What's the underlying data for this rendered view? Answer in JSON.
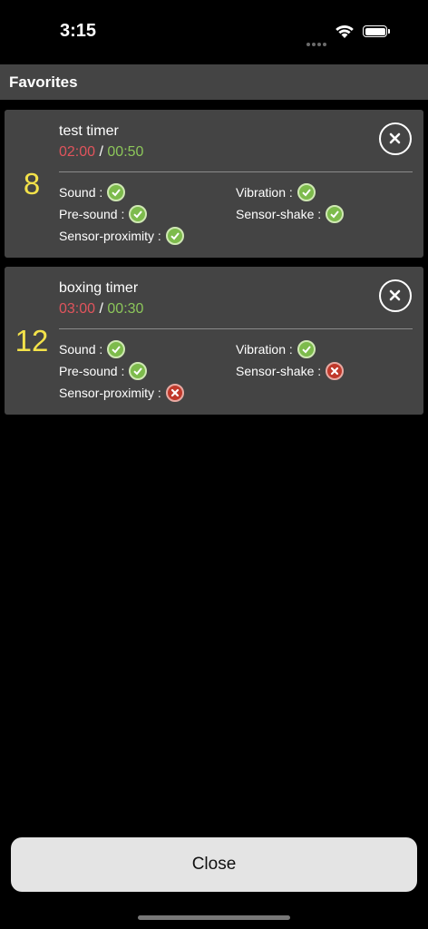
{
  "status_bar": {
    "time": "3:15"
  },
  "header": {
    "title": "Favorites"
  },
  "cards": [
    {
      "number": "8",
      "name": "test timer",
      "time_main": "02:00",
      "time_separator": "/",
      "time_rest": "00:50",
      "options": [
        {
          "label": "Sound :",
          "enabled": true
        },
        {
          "label": "Vibration :",
          "enabled": true
        },
        {
          "label": "Pre-sound :",
          "enabled": true
        },
        {
          "label": "Sensor-shake :",
          "enabled": true
        },
        {
          "label": "Sensor-proximity :",
          "enabled": true
        }
      ]
    },
    {
      "number": "12",
      "name": "boxing timer",
      "time_main": "03:00",
      "time_separator": "/",
      "time_rest": "00:30",
      "options": [
        {
          "label": "Sound :",
          "enabled": true
        },
        {
          "label": "Vibration :",
          "enabled": true
        },
        {
          "label": "Pre-sound :",
          "enabled": true
        },
        {
          "label": "Sensor-shake :",
          "enabled": false
        },
        {
          "label": "Sensor-proximity :",
          "enabled": false
        }
      ]
    }
  ],
  "footer": {
    "close_label": "Close"
  },
  "colors": {
    "accent_yellow": "#f3e24a",
    "time_red": "#e0545c",
    "time_green": "#8cc65a",
    "ok_green": "#7dbb4c",
    "fail_red": "#c0392b"
  },
  "icons": {
    "enabled": "check-circle-icon",
    "disabled": "x-circle-icon",
    "remove": "close-circle-icon"
  }
}
